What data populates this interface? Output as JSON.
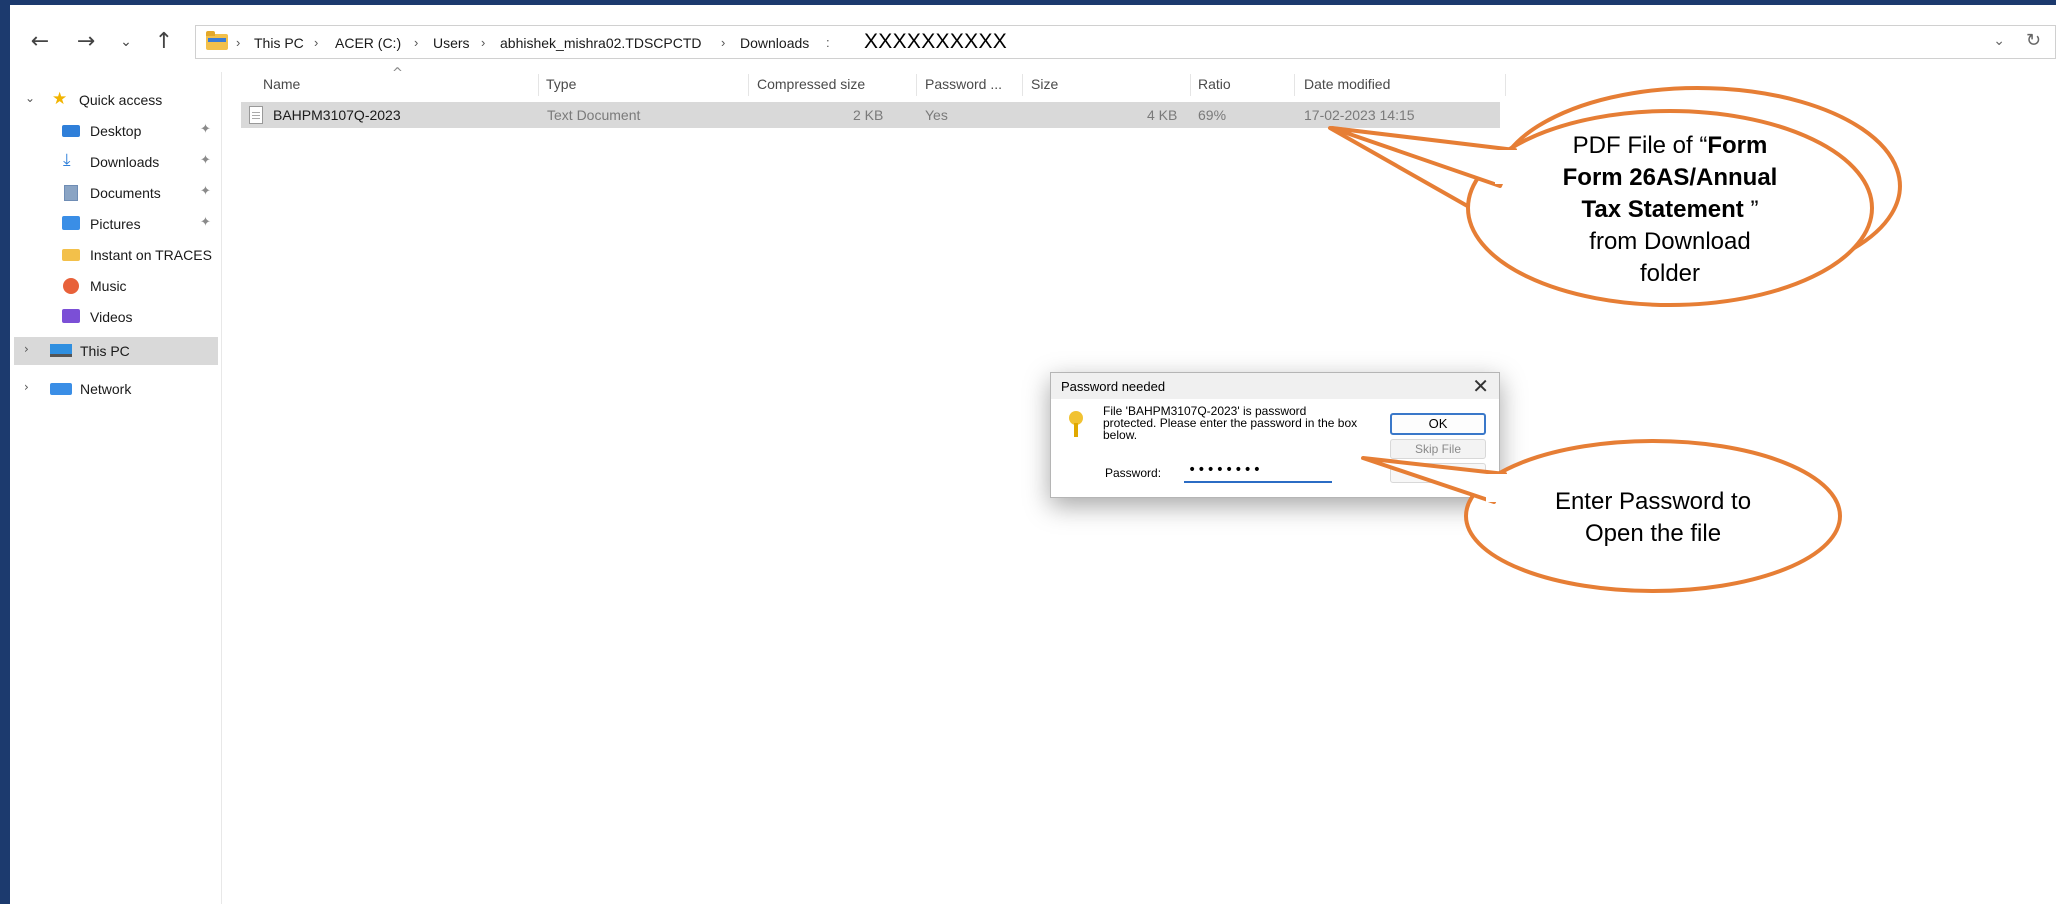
{
  "nav": {
    "back_glyph": "←",
    "forward_glyph": "→",
    "recent_glyph": "⌄",
    "up_glyph": "↑"
  },
  "address": {
    "segments": [
      "This PC",
      "ACER (C:)",
      "Users",
      "abhishek_mishra02.TDSCPCTD",
      "Downloads"
    ],
    "trailing_sep": ":",
    "masked_text": "XXXXXXXXXX",
    "dropdown_glyph": "⌄",
    "refresh_glyph": "↻"
  },
  "sidebar": {
    "quick_access": "Quick access",
    "items": [
      {
        "label": "Desktop",
        "icon": "desktop-icon",
        "pinned": true
      },
      {
        "label": "Downloads",
        "icon": "download-icon",
        "pinned": true
      },
      {
        "label": "Documents",
        "icon": "documents-icon",
        "pinned": true
      },
      {
        "label": "Pictures",
        "icon": "pictures-icon",
        "pinned": true
      },
      {
        "label": "Instant on TRACES",
        "icon": "folder-icon",
        "pinned": false
      },
      {
        "label": "Music",
        "icon": "music-icon",
        "pinned": false
      },
      {
        "label": "Videos",
        "icon": "videos-icon",
        "pinned": false
      }
    ],
    "this_pc": "This PC",
    "network": "Network",
    "pin_glyph": "📌",
    "expand_glyph": "›",
    "collapse_glyph": "⌄"
  },
  "columns": {
    "name": "Name",
    "type": "Type",
    "compressed": "Compressed size",
    "password": "Password ...",
    "size": "Size",
    "ratio": "Ratio",
    "date": "Date modified",
    "sort_glyph": "^"
  },
  "file": {
    "name": "BAHPM3107Q-2023",
    "type": "Text Document",
    "compressed": "2 KB",
    "password": "Yes",
    "size": "4 KB",
    "ratio": "69%",
    "date": "17-02-2023 14:15"
  },
  "dialog": {
    "title": "Password needed",
    "close_glyph": "✕",
    "message": "File 'BAHPM3107Q-2023' is password protected.  Please enter the password in the box below.",
    "password_label": "Password:",
    "password_value": "••••••••",
    "ok_label": "OK",
    "skip_label": "Skip File"
  },
  "callouts": {
    "pdf_pre": "PDF File of “",
    "pdf_bold1": "Form",
    "pdf_bold2": "Form 26AS/Annual",
    "pdf_bold3": "Tax Statement",
    "pdf_post_quote": " ”",
    "pdf_line4": "from Download",
    "pdf_line5": "folder",
    "pw_line1": "Enter Password to",
    "pw_line2": "Open the file",
    "stroke_color": "#e67e35"
  }
}
